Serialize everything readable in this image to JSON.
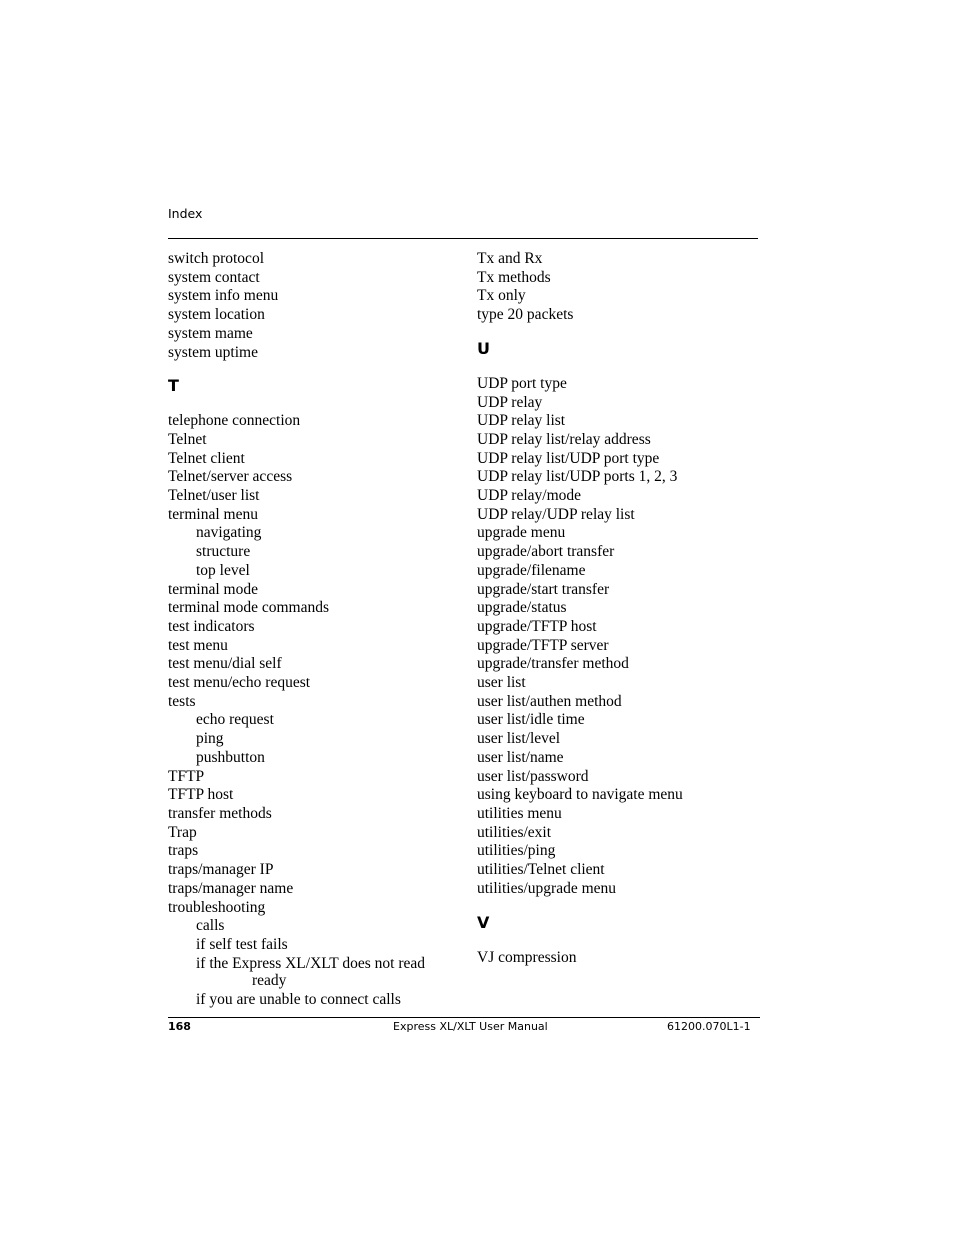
{
  "header": {
    "section": "Index"
  },
  "left_column": {
    "group_s": [
      "switch protocol",
      "system contact",
      "system info menu",
      "system location",
      "system mame",
      "system uptime"
    ],
    "letter_t": "T",
    "group_t": [
      {
        "text": "telephone connection",
        "level": 0
      },
      {
        "text": "Telnet",
        "level": 0
      },
      {
        "text": "Telnet client",
        "level": 0
      },
      {
        "text": "Telnet/server access",
        "level": 0
      },
      {
        "text": "Telnet/user list",
        "level": 0
      },
      {
        "text": "terminal menu",
        "level": 0
      },
      {
        "text": "navigating",
        "level": 1
      },
      {
        "text": "structure",
        "level": 1
      },
      {
        "text": "top level",
        "level": 1
      },
      {
        "text": "terminal mode",
        "level": 0
      },
      {
        "text": "terminal mode commands",
        "level": 0
      },
      {
        "text": "test indicators",
        "level": 0
      },
      {
        "text": "test menu",
        "level": 0
      },
      {
        "text": "test menu/dial self",
        "level": 0
      },
      {
        "text": "test menu/echo request",
        "level": 0
      },
      {
        "text": "tests",
        "level": 0
      },
      {
        "text": "echo request",
        "level": 1
      },
      {
        "text": "ping",
        "level": 1
      },
      {
        "text": "pushbutton",
        "level": 1
      },
      {
        "text": "TFTP",
        "level": 0
      },
      {
        "text": "TFTP host",
        "level": 0
      },
      {
        "text": "transfer methods",
        "level": 0
      },
      {
        "text": "Trap",
        "level": 0
      },
      {
        "text": "traps",
        "level": 0
      },
      {
        "text": "traps/manager IP",
        "level": 0
      },
      {
        "text": "traps/manager name",
        "level": 0
      },
      {
        "text": "troubleshooting",
        "level": 0
      },
      {
        "text": "calls",
        "level": 1
      },
      {
        "text": "if self test fails",
        "level": 1
      },
      {
        "text": "if the Express XL/XLT does not read",
        "level": 1
      },
      {
        "text": "ready",
        "level": 2
      },
      {
        "text": "if you are unable to connect calls",
        "level": 1
      }
    ]
  },
  "right_column": {
    "group_t_cont": [
      "Tx and Rx",
      "Tx methods",
      "Tx only",
      "type 20 packets"
    ],
    "letter_u": "U",
    "group_u": [
      "UDP port type",
      "UDP relay",
      "UDP relay list",
      "UDP relay list/relay address",
      "UDP relay list/UDP port type",
      "UDP relay list/UDP ports 1, 2, 3",
      "UDP relay/mode",
      "UDP relay/UDP relay list",
      "upgrade menu",
      "upgrade/abort transfer",
      "upgrade/filename",
      "upgrade/start transfer",
      "upgrade/status",
      "upgrade/TFTP host",
      "upgrade/TFTP server",
      "upgrade/transfer method",
      "user list",
      "user list/authen method",
      "user list/idle time",
      "user list/level",
      "user list/name",
      "user list/password",
      "using keyboard to navigate menu",
      "utilities menu",
      "utilities/exit",
      "utilities/ping",
      "utilities/Telnet client",
      "utilities/upgrade menu"
    ],
    "letter_v": "V",
    "group_v": [
      "VJ compression"
    ]
  },
  "footer": {
    "page_number": "168",
    "manual_title": "Express XL/XLT User Manual",
    "doc_number": "61200.070L1-1"
  }
}
